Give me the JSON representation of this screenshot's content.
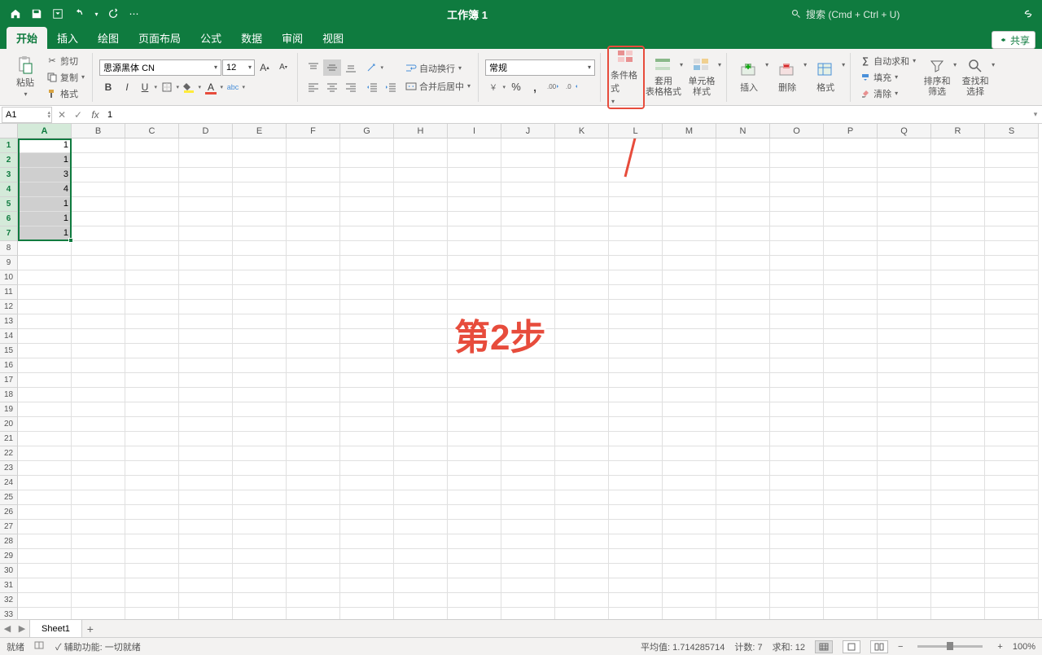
{
  "titlebar": {
    "title": "工作簿 1",
    "search_placeholder": "搜索 (Cmd + Ctrl + U)"
  },
  "tabs": {
    "items": [
      "开始",
      "插入",
      "绘图",
      "页面布局",
      "公式",
      "数据",
      "审阅",
      "视图"
    ],
    "active_index": 0,
    "share": "共享"
  },
  "ribbon": {
    "clipboard": {
      "paste": "粘贴",
      "cut": "剪切",
      "copy": "复制",
      "format": "格式"
    },
    "font": {
      "name": "思源黑体 CN",
      "size": "12"
    },
    "alignment": {
      "wrap": "自动换行",
      "merge": "合并后居中"
    },
    "number": {
      "format": "常规"
    },
    "styles": {
      "cond": "条件格式",
      "table": "套用\n表格格式",
      "cell": "单元格\n样式"
    },
    "cells": {
      "insert": "插入",
      "delete": "删除",
      "format": "格式"
    },
    "editing": {
      "sum": "自动求和",
      "fill": "填充",
      "clear": "清除",
      "sort": "排序和\n筛选",
      "find": "查找和\n选择"
    }
  },
  "fxbar": {
    "name": "A1",
    "formula": "1"
  },
  "grid": {
    "columns": [
      "A",
      "B",
      "C",
      "D",
      "E",
      "F",
      "G",
      "H",
      "I",
      "J",
      "K",
      "L",
      "M",
      "N",
      "O",
      "P",
      "Q",
      "R",
      "S"
    ],
    "rows": 33,
    "selected_col": 0,
    "selected_rows": [
      1,
      2,
      3,
      4,
      5,
      6,
      7
    ],
    "cells": {
      "A1": "1",
      "A2": "1",
      "A3": "3",
      "A4": "4",
      "A5": "1",
      "A6": "1",
      "A7": "1"
    }
  },
  "annotation": {
    "text": "第2步"
  },
  "sheettabs": {
    "active": "Sheet1"
  },
  "statusbar": {
    "ready": "就绪",
    "a11y": "辅助功能: 一切就绪",
    "avg_label": "平均值:",
    "avg": "1.714285714",
    "count_label": "计数:",
    "count": "7",
    "sum_label": "求和:",
    "sum": "12",
    "zoom": "100%"
  }
}
